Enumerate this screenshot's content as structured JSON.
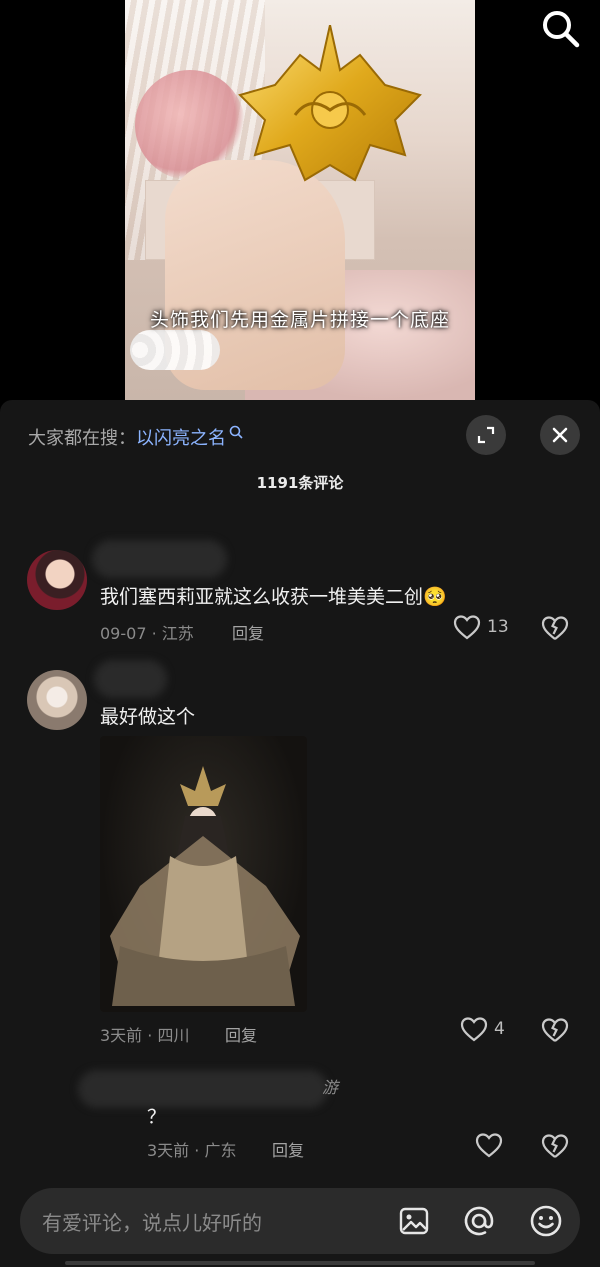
{
  "video": {
    "caption": "头饰我们先用金属片拼接一个底座"
  },
  "sheet": {
    "hot_search_label": "大家都在搜：",
    "hot_search_keyword": "以闪亮之名",
    "comment_count_title": "1191条评论"
  },
  "comments": [
    {
      "text": "我们塞西莉亚就这么收获一堆美美二创",
      "emoji": "🥺",
      "time": "09-07",
      "location": "江苏",
      "reply_label": "回复",
      "likes": "13"
    },
    {
      "text": "最好做这个",
      "time": "3天前",
      "location": "四川",
      "reply_label": "回复",
      "likes": "4"
    },
    {
      "name_suffix": "游",
      "text": "？",
      "time": "3天前",
      "location": "广东",
      "reply_label": "回复",
      "likes": ""
    }
  ],
  "input": {
    "placeholder": "有爱评论，说点儿好听的"
  },
  "icons": {
    "top": "search-icon",
    "expand": "expand-icon",
    "close": "close-icon",
    "like": "heart-icon",
    "dislike": "broken-heart-icon",
    "image": "image-icon",
    "mention": "at-icon",
    "emoji": "emoji-icon"
  },
  "colors": {
    "keyword": "#8cb4ff",
    "sheet_bg": "#161616"
  }
}
